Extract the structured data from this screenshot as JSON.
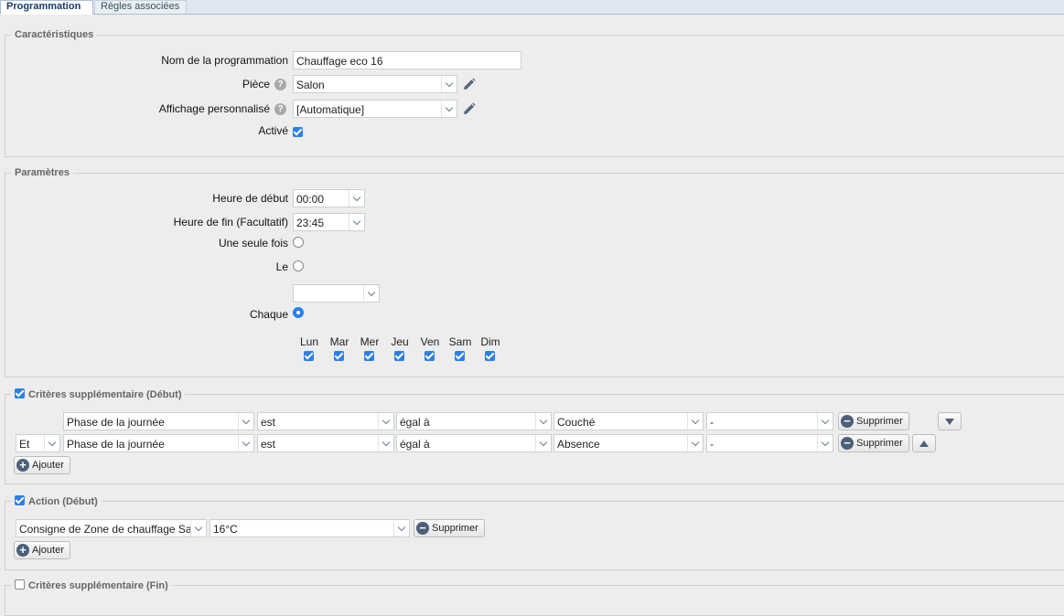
{
  "tabs": [
    {
      "label": "Programmation"
    },
    {
      "label": "Règles associées"
    }
  ],
  "caracteristiques": {
    "legend": "Caractéristiques",
    "nom_label": "Nom de la programmation",
    "nom_value": "Chauffage eco 16",
    "piece_label": "Pièce",
    "piece_value": "Salon",
    "affichage_label": "Affichage personnalisé",
    "affichage_value": "[Automatique]",
    "active_label": "Activé",
    "help_glyph": "?"
  },
  "parametres": {
    "legend": "Paramètres",
    "heure_debut_label": "Heure de début",
    "heure_debut_value": "00:00",
    "heure_fin_label": "Heure de fin (Facultatif)",
    "heure_fin_value": "23:45",
    "une_seule_fois_label": "Une seule fois",
    "le_label": "Le",
    "chaque_label": "Chaque",
    "days": [
      "Lun",
      "Mar",
      "Mer",
      "Jeu",
      "Ven",
      "Sam",
      "Dim"
    ]
  },
  "criteres_debut": {
    "legend": "Critères supplémentaire (Début)",
    "rows": [
      {
        "connector": "",
        "field": "Phase de la journée",
        "verb": "est",
        "op": "égal à",
        "value": "Couché",
        "extra": "-",
        "delete_label": "Supprimer"
      },
      {
        "connector": "Et",
        "field": "Phase de la journée",
        "verb": "est",
        "op": "égal à",
        "value": "Absence",
        "extra": "-",
        "delete_label": "Supprimer"
      }
    ],
    "add_label": "Ajouter"
  },
  "action_debut": {
    "legend": "Action (Début)",
    "target": "Consigne de Zone de chauffage Sal",
    "value": "16°C",
    "delete_label": "Supprimer",
    "add_label": "Ajouter"
  },
  "criteres_fin": {
    "legend": "Critères supplémentaire (Fin)"
  },
  "colors": {
    "accent": "#2a80e8",
    "tab_text": "#1a3a66",
    "icon": "#4b5f78"
  }
}
